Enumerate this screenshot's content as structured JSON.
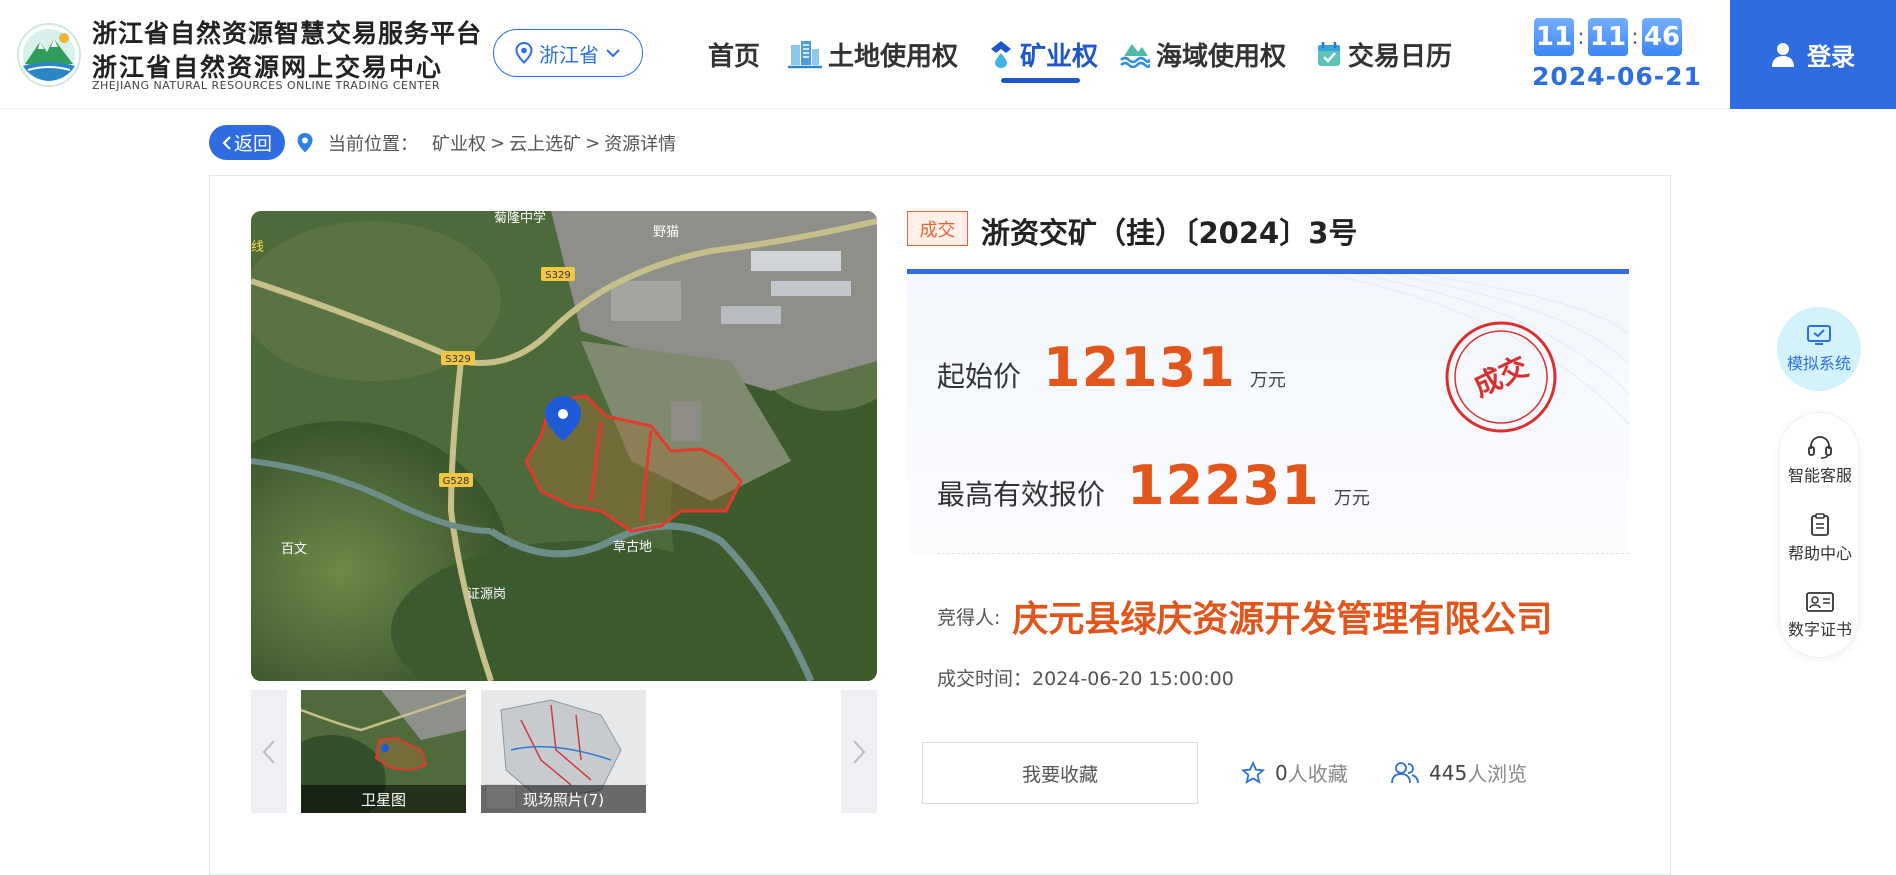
{
  "header": {
    "brand_line1": "浙江省自然资源智慧交易服务平台",
    "brand_line2": "浙江省自然资源网上交易中心",
    "brand_line3": "ZHEJIANG NATURAL RESOURCES ONLINE TRADING CENTER",
    "region": "浙江省",
    "nav": [
      {
        "label": "首页",
        "icon": "none"
      },
      {
        "label": "土地使用权",
        "icon": "building-icon"
      },
      {
        "label": "矿业权",
        "icon": "mine-icon",
        "active": true
      },
      {
        "label": "海域使用权",
        "icon": "wave-icon"
      },
      {
        "label": "交易日历",
        "icon": "calendar-icon"
      }
    ],
    "clock": {
      "hh": "11",
      "mm": "11",
      "ss": "46",
      "sep": ":"
    },
    "date": "2024-06-21",
    "login": "登录"
  },
  "breadcrumb": {
    "back": "返回",
    "prefix": "当前位置：",
    "items": [
      "矿业权",
      ">",
      "云上选矿",
      ">",
      "资源详情"
    ]
  },
  "map": {
    "labels": {
      "school": "菊隆中学",
      "yemao": "野猫",
      "s329a": "S329",
      "s329b": "S329",
      "g528": "G528",
      "baiwen": "百文",
      "caogudi": "草古地",
      "place": "证源岗",
      "edge": "线"
    }
  },
  "thumbnails": [
    {
      "label": "卫星图"
    },
    {
      "label": "现场照片(7)"
    }
  ],
  "detail": {
    "status": "成交",
    "title": "浙资交矿（挂）〔2024〕3号",
    "start_price_label": "起始价",
    "start_price": "12131",
    "start_price_unit": "万元",
    "max_price_label": "最高有效报价",
    "max_price": "12231",
    "max_price_unit": "万元",
    "stamp": "成交",
    "winner_label": "竞得人:",
    "winner": "庆元县绿庆资源开发管理有限公司",
    "deal_time_label": "成交时间：",
    "deal_time": "2024-06-20 15:00:00",
    "favorite_button": "我要收藏",
    "fav_count": "0",
    "fav_suffix": "人收藏",
    "view_count": "445",
    "view_suffix": "人浏览"
  },
  "sidebar": {
    "simulate": "模拟系统",
    "items": [
      {
        "label": "智能客服",
        "icon": "headset-icon"
      },
      {
        "label": "帮助中心",
        "icon": "clipboard-icon"
      },
      {
        "label": "数字证书",
        "icon": "id-card-icon"
      }
    ]
  },
  "colors": {
    "primary": "#2f6ce0",
    "accent": "#e2561c",
    "nav_active": "#1d57c8"
  }
}
